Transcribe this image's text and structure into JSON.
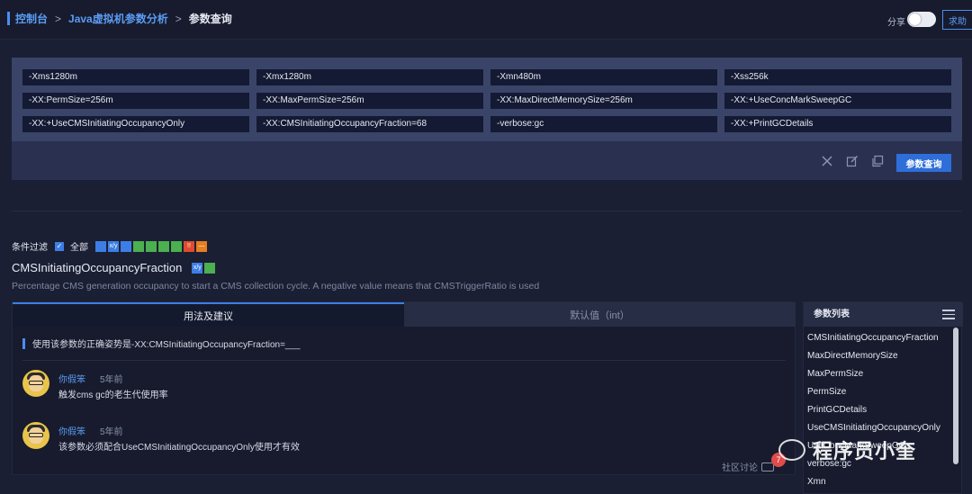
{
  "header": {
    "breadcrumb": [
      "控制台",
      "Java虚拟机参数分析",
      "参数查询"
    ],
    "breadcrumb_sep": ">",
    "share_label": "分享",
    "help_label": "求助"
  },
  "params": [
    "-Xms1280m",
    "-Xmx1280m",
    "-Xmn480m",
    "-Xss256k",
    "-XX:PermSize=256m",
    "-XX:MaxPermSize=256m",
    "-XX:MaxDirectMemorySize=256m",
    "-XX:+UseConcMarkSweepGC",
    "-XX:+UseCMSInitiatingOccupancyOnly",
    "-XX:CMSInitiatingOccupancyFraction=68",
    "-verbose:gc",
    "-XX:+PrintGCDetails"
  ],
  "actions": {
    "clear_icon": "close-icon",
    "edit_icon": "edit-icon",
    "copy_icon": "copy-icon",
    "query_label": "参数查询"
  },
  "filter": {
    "label": "条件过滤",
    "all_label": "全部",
    "check_mark": "✓",
    "swatches": [
      {
        "color": "#3d7ee6",
        "text": ""
      },
      {
        "color": "#3d7ee6",
        "text": "x/y"
      },
      {
        "color": "#3d7ee6",
        "text": ""
      },
      {
        "color": "#4caf50",
        "text": ""
      },
      {
        "color": "#4caf50",
        "text": ""
      },
      {
        "color": "#4caf50",
        "text": ""
      },
      {
        "color": "#4caf50",
        "text": ""
      },
      {
        "color": "#e04b2e",
        "text": "!!"
      },
      {
        "color": "#e67e22",
        "text": "—"
      }
    ]
  },
  "param_detail": {
    "name": "CMSInitiatingOccupancyFraction",
    "tag1_color": "#3d7ee6",
    "tag1_text": "x/y",
    "tag2_color": "#4caf50",
    "description": "Percentage CMS generation occupancy to start a CMS collection cycle. A negative value means that CMSTriggerRatio is used"
  },
  "tabs": [
    {
      "label": "用法及建议",
      "active": true
    },
    {
      "label": "默认值（int）",
      "active": false
    }
  ],
  "usage_text": "使用该参数的正确姿势是-XX:CMSInitiatingOccupancyFraction=___",
  "comments": [
    {
      "user": "你假笨",
      "time": "5年前",
      "text": "触发cms gc的老生代使用率"
    },
    {
      "user": "你假笨",
      "time": "5年前",
      "text": "该参数必须配合UseCMSInitiatingOccupancyOnly使用才有效"
    }
  ],
  "discuss": {
    "label": "社区讨论",
    "count": "7"
  },
  "side": {
    "title": "参数列表",
    "items": [
      "CMSInitiatingOccupancyFraction",
      "MaxDirectMemorySize",
      "MaxPermSize",
      "PermSize",
      "PrintGCDetails",
      "UseCMSInitiatingOccupancyOnly",
      "UseConcMarkSweepGC",
      "verbose:gc",
      "Xmn"
    ]
  },
  "watermark": {
    "text": "程序员小奎"
  }
}
